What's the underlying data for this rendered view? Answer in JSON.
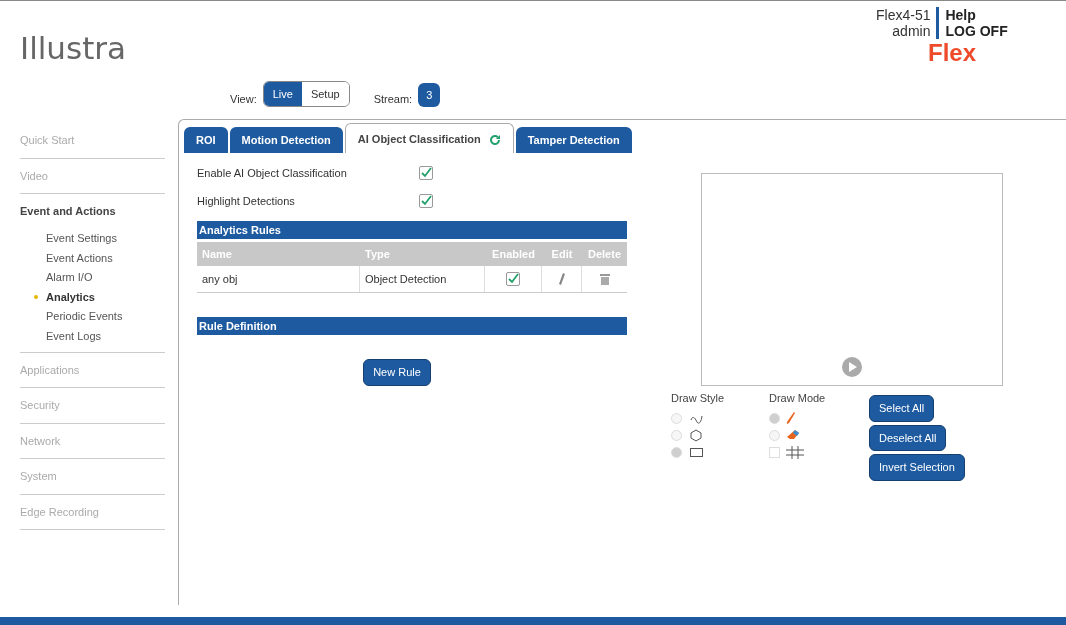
{
  "header": {
    "logo": "Illustra",
    "device": "Flex4-51",
    "user": "admin",
    "links": [
      "Help",
      "LOG OFF"
    ],
    "brand": "Flex"
  },
  "view": {
    "label": "View:",
    "options": [
      {
        "label": "Live",
        "selected": true
      },
      {
        "label": "Setup",
        "selected": false
      }
    ]
  },
  "stream": {
    "label": "Stream:",
    "value": "3"
  },
  "sidebar": {
    "items": [
      {
        "label": "Quick Start",
        "expanded": false
      },
      {
        "label": "Video",
        "expanded": false
      },
      {
        "label": "Event and Actions",
        "expanded": true,
        "children": [
          {
            "label": "Event Settings",
            "selected": false
          },
          {
            "label": "Event Actions",
            "selected": false
          },
          {
            "label": "Alarm I/O",
            "selected": false
          },
          {
            "label": "Analytics",
            "selected": true
          },
          {
            "label": "Periodic Events",
            "selected": false
          },
          {
            "label": "Event Logs",
            "selected": false
          }
        ]
      },
      {
        "label": "Applications",
        "expanded": false
      },
      {
        "label": "Security",
        "expanded": false
      },
      {
        "label": "Network",
        "expanded": false
      },
      {
        "label": "System",
        "expanded": false
      },
      {
        "label": "Edge Recording",
        "expanded": false
      }
    ]
  },
  "tabs": [
    {
      "label": "ROI",
      "selected": false
    },
    {
      "label": "Motion Detection",
      "selected": false
    },
    {
      "label": "AI Object Classification",
      "selected": true
    },
    {
      "label": "Tamper Detection",
      "selected": false
    }
  ],
  "options": [
    {
      "label": "Enable AI Object Classification",
      "checked": true
    },
    {
      "label": "Highlight Detections",
      "checked": true
    }
  ],
  "analytics_rules": {
    "title": "Analytics Rules",
    "columns": [
      "Name",
      "Type",
      "Enabled",
      "Edit",
      "Delete"
    ],
    "rows": [
      {
        "name": "any obj",
        "type": "Object Detection",
        "enabled": true
      }
    ]
  },
  "rule_definition": {
    "title": "Rule Definition"
  },
  "new_rule": "New Rule",
  "draw_style": {
    "title": "Draw Style",
    "options": [
      {
        "kind": "freeform",
        "selected": false
      },
      {
        "kind": "polygon",
        "selected": false
      },
      {
        "kind": "rectangle",
        "selected": true
      }
    ]
  },
  "draw_mode": {
    "title": "Draw Mode",
    "options": [
      {
        "kind": "pencil",
        "selected": true
      },
      {
        "kind": "eraser",
        "selected": false
      },
      {
        "kind": "grid",
        "checked": false
      }
    ]
  },
  "selection_buttons": [
    "Select All",
    "Deselect All",
    "Invert Selection"
  ]
}
